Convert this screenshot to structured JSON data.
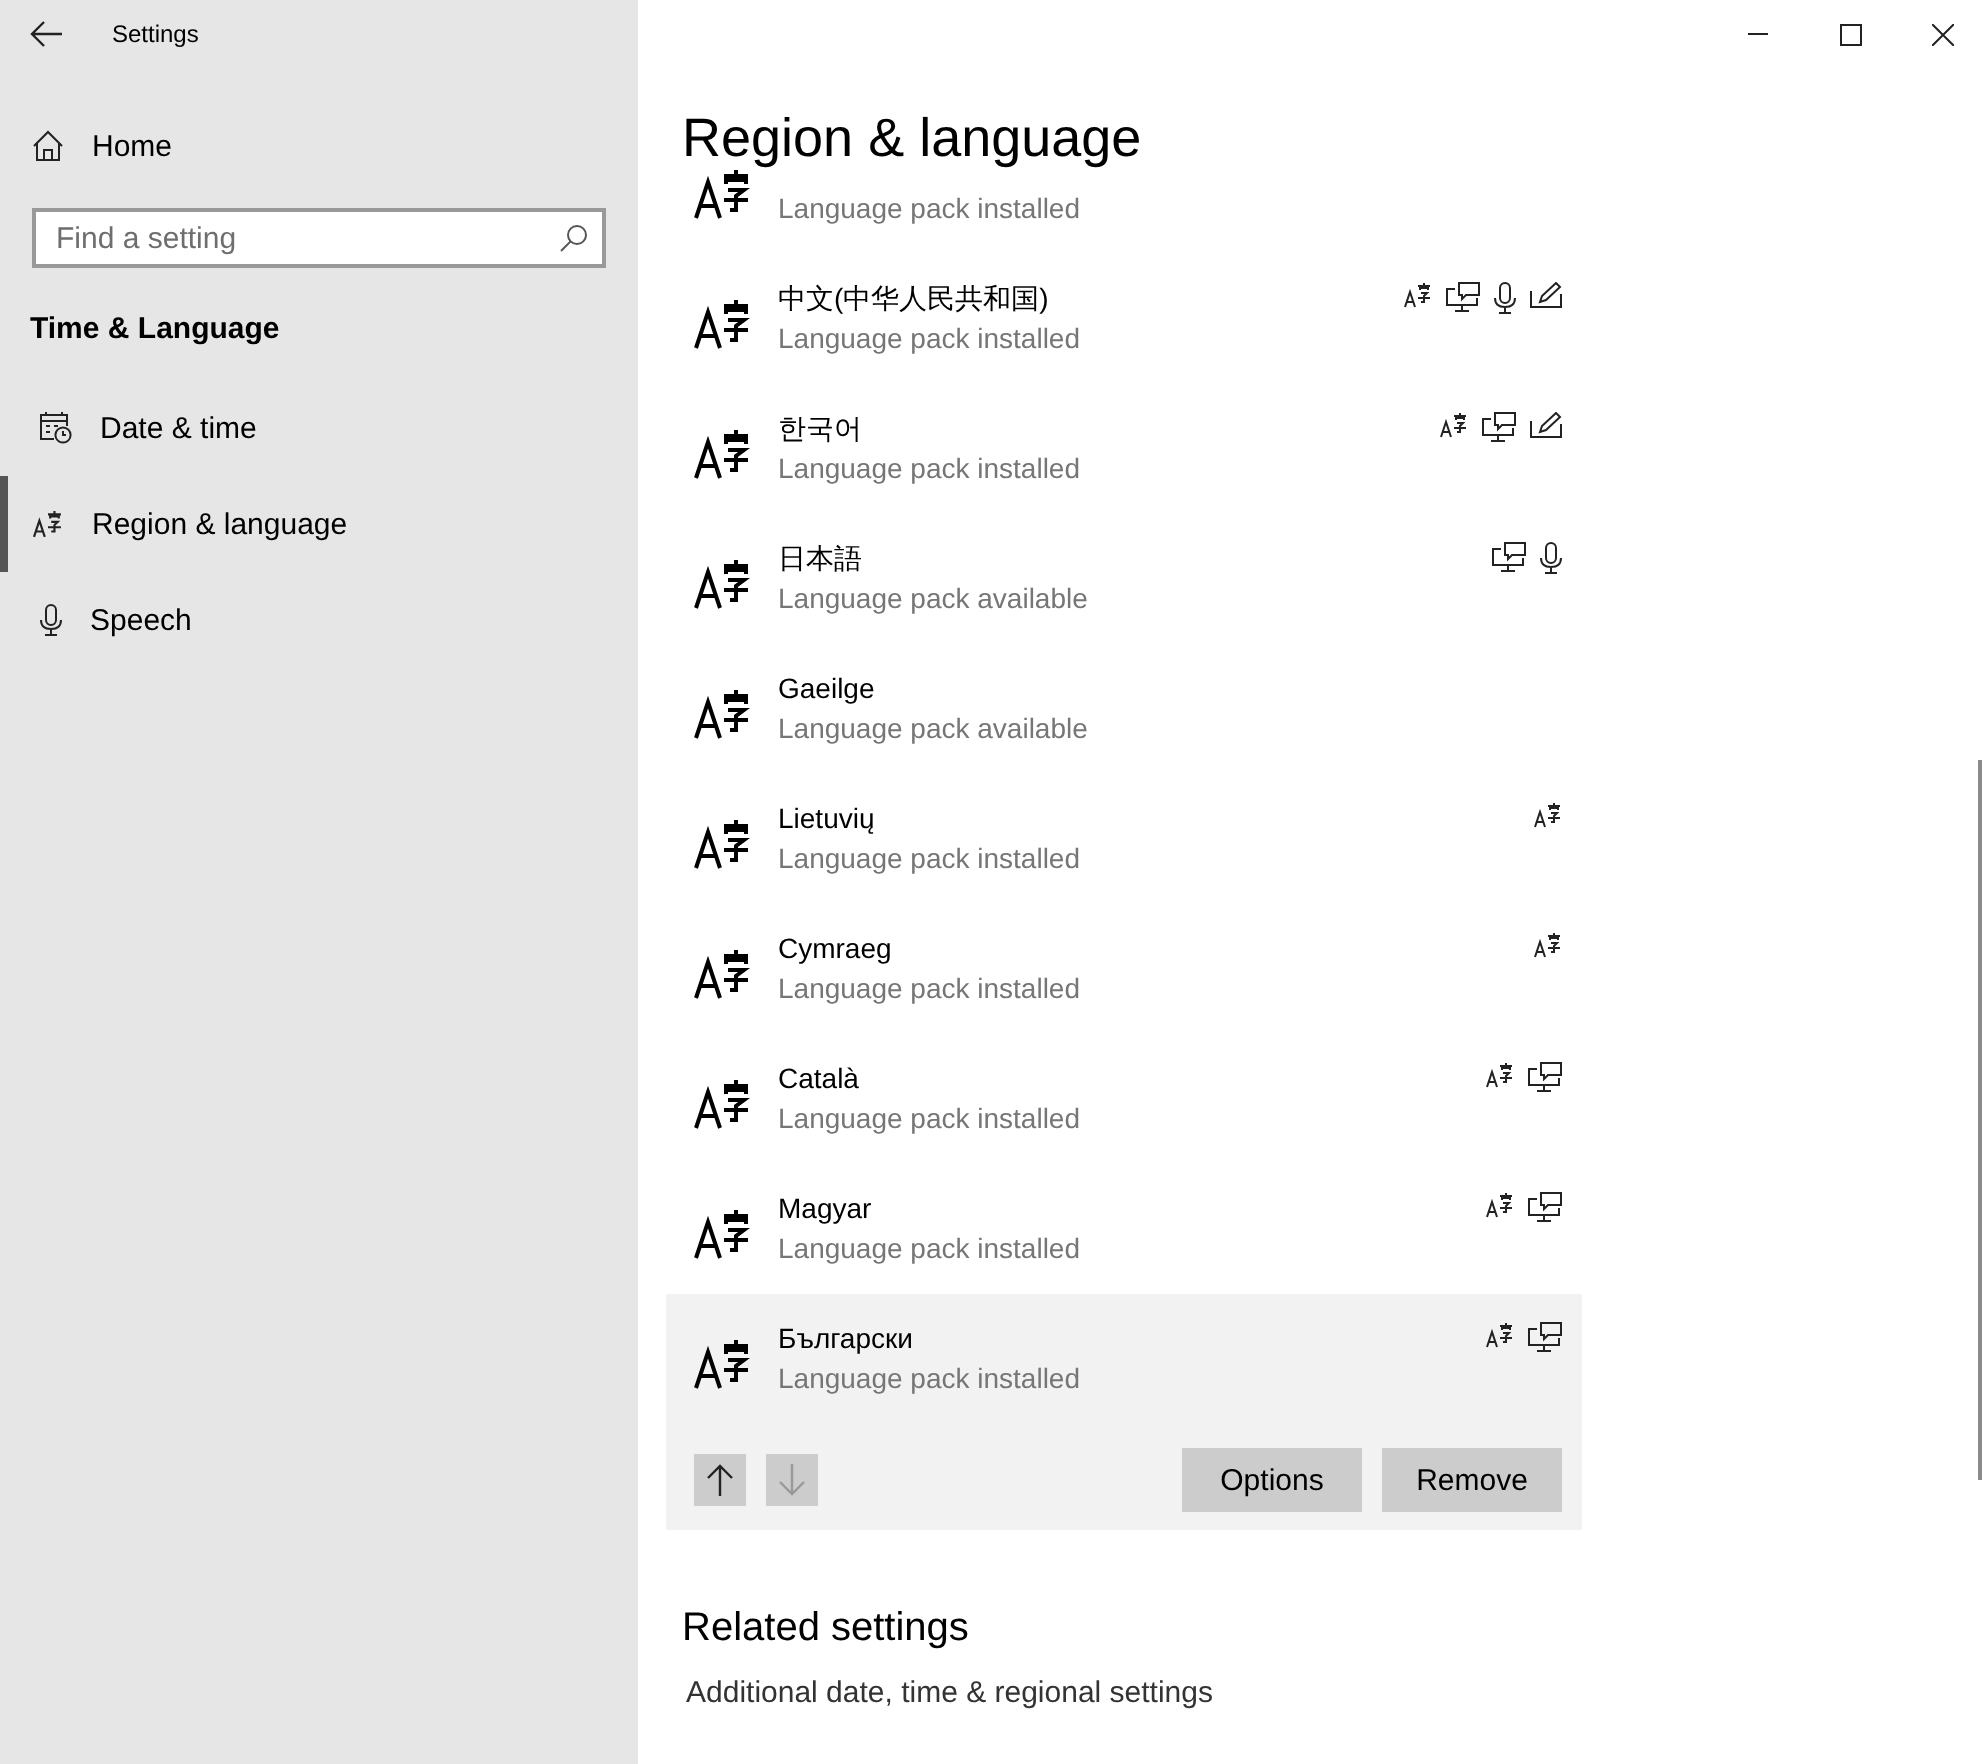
{
  "window": {
    "title": "Settings"
  },
  "sidebar": {
    "home": "Home",
    "search": {
      "placeholder": "Find a setting"
    },
    "section": "Time & Language",
    "items": [
      {
        "label": "Date & time",
        "kind": "calendar",
        "selected": false
      },
      {
        "label": "Region & language",
        "kind": "language",
        "selected": true
      },
      {
        "label": "Speech",
        "kind": "microphone",
        "selected": false
      }
    ]
  },
  "page": {
    "title": "Region & language",
    "languages": [
      {
        "status": "Language pack installed",
        "selected": false
      },
      {
        "name": "中文(中华人民共和国)",
        "status": "Language pack installed",
        "features": [
          {
            "kind": "display-language"
          },
          {
            "kind": "text-to-speech"
          },
          {
            "kind": "speech"
          },
          {
            "kind": "handwriting"
          }
        ],
        "selected": false
      },
      {
        "name": "한국어",
        "status": "Language pack installed",
        "features": [
          {
            "kind": "display-language"
          },
          {
            "kind": "text-to-speech"
          },
          {
            "kind": "handwriting"
          }
        ],
        "selected": false
      },
      {
        "name": "日本語",
        "status": "Language pack available",
        "features": [
          {
            "kind": "text-to-speech"
          },
          {
            "kind": "speech"
          }
        ],
        "selected": false
      },
      {
        "name": "Gaeilge",
        "status": "Language pack available",
        "selected": false
      },
      {
        "name": "Lietuvių",
        "status": "Language pack installed",
        "features": [
          {
            "kind": "display-language"
          }
        ],
        "selected": false
      },
      {
        "name": "Cymraeg",
        "status": "Language pack installed",
        "features": [
          {
            "kind": "display-language"
          }
        ],
        "selected": false
      },
      {
        "name": "Català",
        "status": "Language pack installed",
        "features": [
          {
            "kind": "display-language"
          },
          {
            "kind": "text-to-speech"
          }
        ],
        "selected": false
      },
      {
        "name": "Magyar",
        "status": "Language pack installed",
        "features": [
          {
            "kind": "display-language"
          },
          {
            "kind": "text-to-speech"
          }
        ],
        "selected": false
      },
      {
        "name": "Български",
        "status": "Language pack installed",
        "features": [
          {
            "kind": "display-language"
          },
          {
            "kind": "text-to-speech"
          }
        ],
        "selected": true
      }
    ],
    "row_actions": {
      "move_up": {
        "disabled": false
      },
      "move_down": {
        "disabled": true
      },
      "buttons": [
        "Options",
        "Remove"
      ]
    },
    "related": {
      "title": "Related settings",
      "links": [
        "Additional date, time & regional settings"
      ]
    }
  }
}
